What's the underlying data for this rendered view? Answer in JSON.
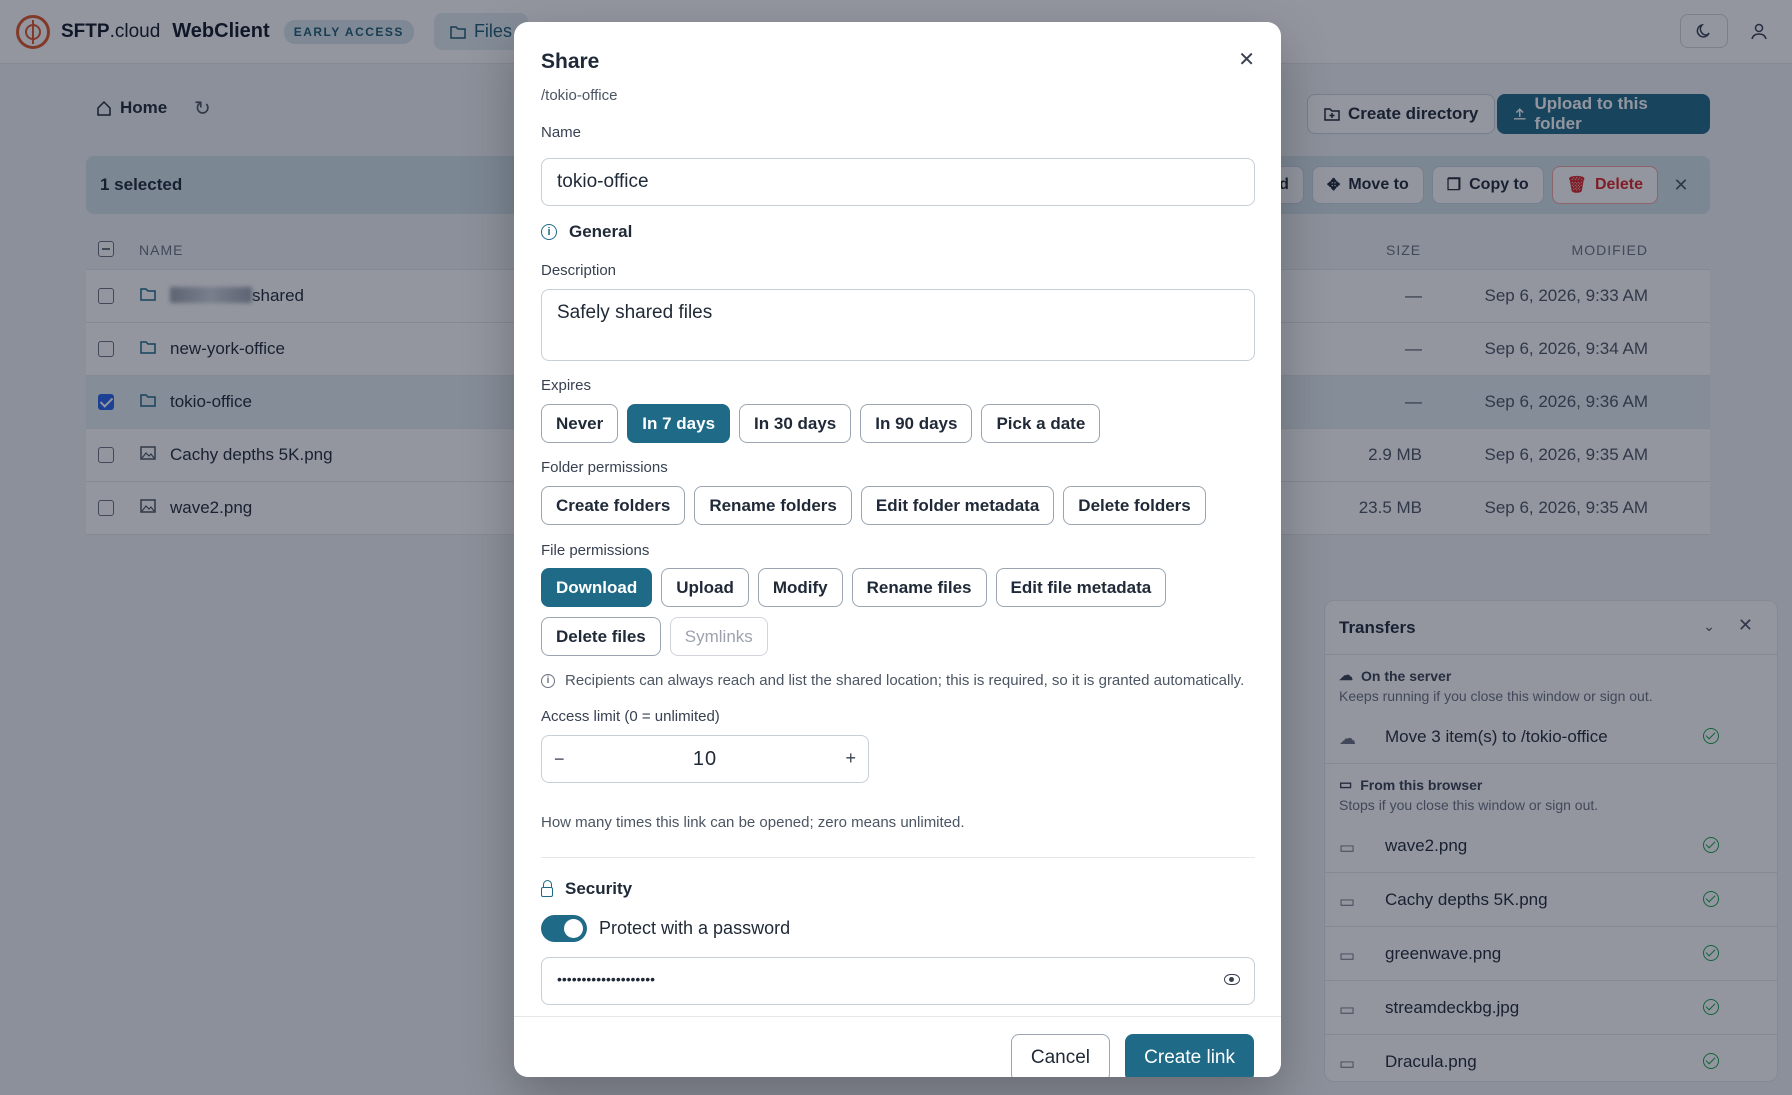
{
  "app": {
    "brand_name": "SFTP",
    "brand_suffix": ".cloud",
    "product": "WebClient",
    "badge": "EARLY ACCESS",
    "files_tab": "Files"
  },
  "toolbar": {
    "home": "Home",
    "create_directory": "Create directory",
    "upload": "Upload to this folder"
  },
  "selection": {
    "count": "1 selected",
    "partial_label": "d",
    "move_to": "Move to",
    "copy_to": "Copy to",
    "delete": "Delete"
  },
  "table": {
    "headers": {
      "name": "NAME",
      "size": "SIZE",
      "modified": "MODIFIED"
    },
    "rows": [
      {
        "name": "shared",
        "size": "—",
        "modified": "Sep 6, 2026, 9:33 AM",
        "type": "folder",
        "selected": false
      },
      {
        "name": "new-york-office",
        "size": "—",
        "modified": "Sep 6, 2026, 9:34 AM",
        "type": "folder",
        "selected": false
      },
      {
        "name": "tokio-office",
        "size": "—",
        "modified": "Sep 6, 2026, 9:36 AM",
        "type": "folder",
        "selected": true
      },
      {
        "name": "Cachy depths 5K.png",
        "size": "2.9 MB",
        "modified": "Sep 6, 2026, 9:35 AM",
        "type": "image",
        "selected": false
      },
      {
        "name": "wave2.png",
        "size": "23.5 MB",
        "modified": "Sep 6, 2026, 9:35 AM",
        "type": "image",
        "selected": false
      }
    ]
  },
  "transfers": {
    "title": "Transfers",
    "server": {
      "title": "On the server",
      "subtitle": "Keeps running if you close this window or sign out.",
      "items": [
        "Move 3 item(s) to /tokio-office"
      ]
    },
    "browser": {
      "title": "From this browser",
      "subtitle": "Stops if you close this window or sign out.",
      "items": [
        "wave2.png",
        "Cachy depths 5K.png",
        "greenwave.png",
        "streamdeckbg.jpg",
        "Dracula.png"
      ]
    }
  },
  "modal": {
    "title": "Share",
    "path": "/tokio-office",
    "name_label": "Name",
    "name_value": "tokio-office",
    "general": "General",
    "description_label": "Description",
    "description_value": "Safely shared files",
    "expires_label": "Expires",
    "expires_options": [
      "Never",
      "In 7 days",
      "In 30 days",
      "In 90 days",
      "Pick a date"
    ],
    "expires_selected": "In 7 days",
    "folder_permissions_label": "Folder permissions",
    "folder_permissions": [
      "Create folders",
      "Rename folders",
      "Edit folder metadata",
      "Delete folders"
    ],
    "file_permissions_label": "File permissions",
    "file_permissions": [
      "Download",
      "Upload",
      "Modify",
      "Rename files",
      "Edit file metadata",
      "Delete files",
      "Symlinks"
    ],
    "file_permissions_selected": [
      "Download"
    ],
    "file_permissions_disabled": [
      "Symlinks"
    ],
    "recipients_note": "Recipients can always reach and list the shared location; this is required, so it is granted automatically.",
    "access_limit_label": "Access limit (0 = unlimited)",
    "access_limit_value": "10",
    "access_limit_hint": "How many times this link can be opened; zero means unlimited.",
    "security": "Security",
    "password_toggle_label": "Protect with a password",
    "password_toggle_on": true,
    "password_value": "••••••••••••••••••••",
    "cancel": "Cancel",
    "create": "Create link"
  },
  "colors": {
    "accent": "#1f6a87",
    "brand": "#e2572b",
    "danger": "#dc2626",
    "success": "#16a34a"
  }
}
